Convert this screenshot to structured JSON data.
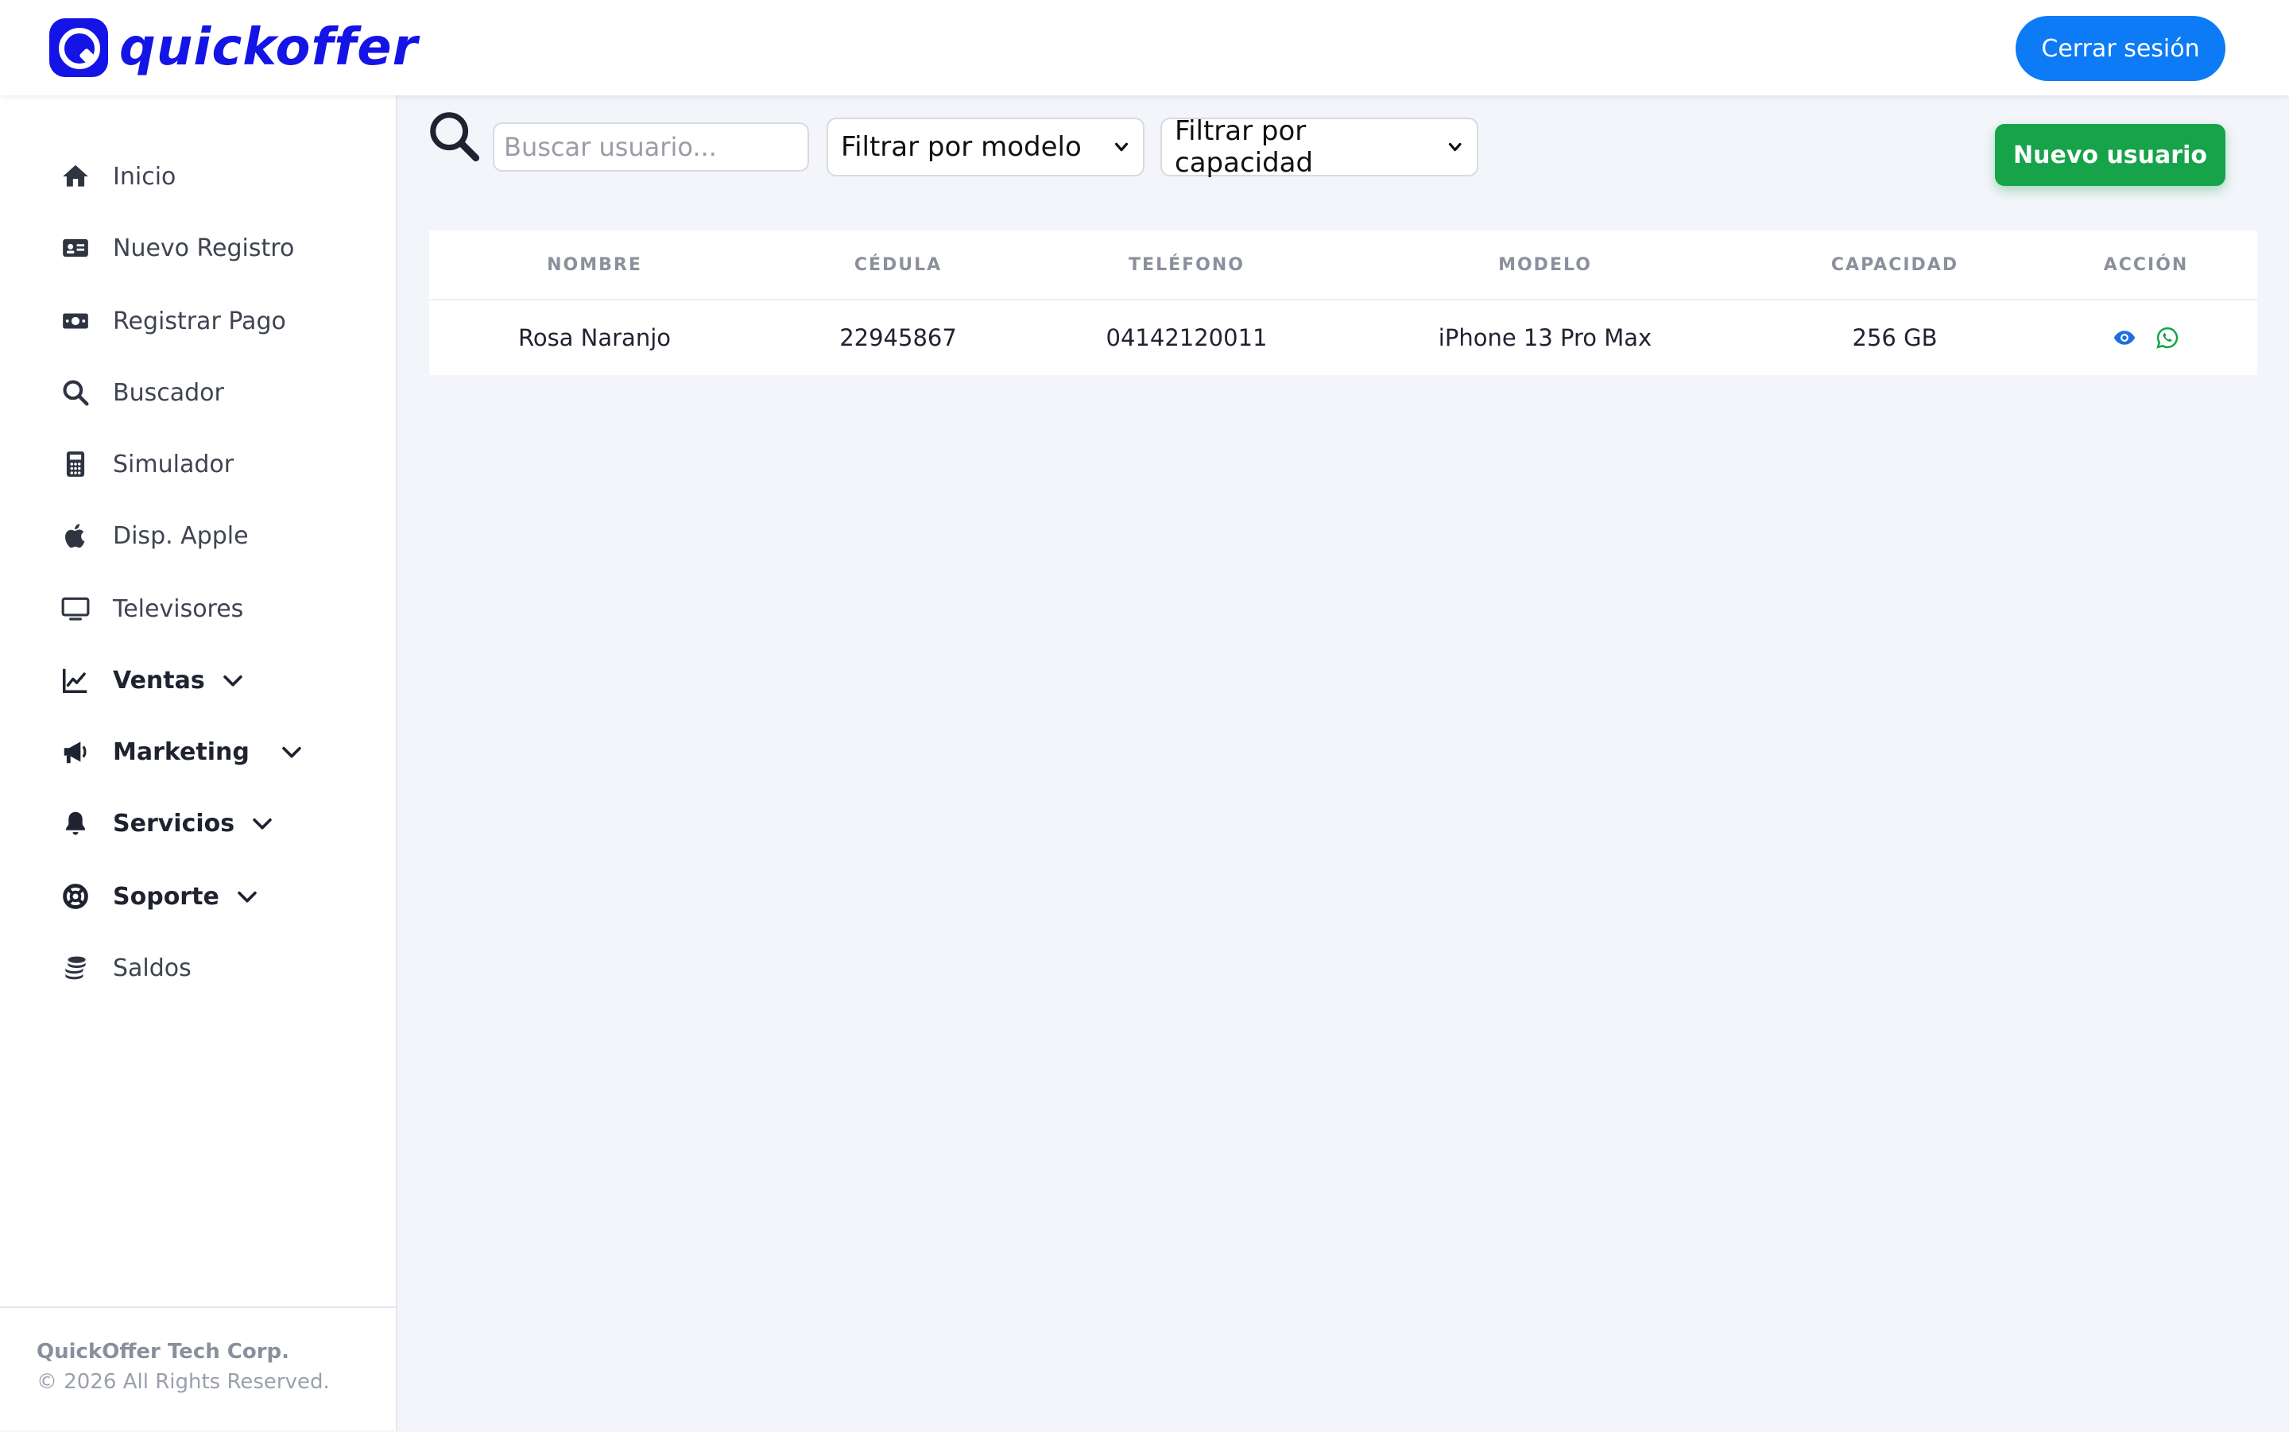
{
  "brand": {
    "name": "quickoffer",
    "primary_color": "#1414e6"
  },
  "header": {
    "logout_label": "Cerrar sesión",
    "logout_color": "#0d7bf6"
  },
  "sidebar": {
    "items": [
      {
        "label": "Inicio",
        "icon": "home-icon"
      },
      {
        "label": "Nuevo Registro",
        "icon": "id-card-icon"
      },
      {
        "label": "Registrar Pago",
        "icon": "money-icon"
      },
      {
        "label": "Buscador",
        "icon": "search-icon"
      },
      {
        "label": "Simulador",
        "icon": "calculator-icon"
      },
      {
        "label": "Disp. Apple",
        "icon": "apple-icon"
      },
      {
        "label": "Televisores",
        "icon": "tv-icon"
      },
      {
        "label": "Ventas",
        "icon": "chart-line-icon",
        "expandable": true
      },
      {
        "label": "Marketing",
        "icon": "megaphone-icon",
        "expandable": true
      },
      {
        "label": "Servicios",
        "icon": "bell-icon",
        "expandable": true
      },
      {
        "label": "Soporte",
        "icon": "lifebuoy-icon",
        "expandable": true
      },
      {
        "label": "Saldos",
        "icon": "coins-icon"
      }
    ],
    "footer": {
      "company": "QuickOffer Tech Corp.",
      "rights": "© 2026 All Rights Reserved."
    }
  },
  "toolbar": {
    "search_placeholder": "Buscar usuario...",
    "filter_model": "Filtrar por modelo",
    "filter_capacity": "Filtrar por capacidad",
    "new_user_label": "Nuevo usuario",
    "new_user_color": "#16a34a"
  },
  "table": {
    "columns": [
      "NOMBRE",
      "CÉDULA",
      "TELÉFONO",
      "MODELO",
      "CAPACIDAD",
      "ACCIÓN"
    ],
    "rows": [
      {
        "nombre": "Rosa Naranjo",
        "cedula": "22945867",
        "telefono": "04142120011",
        "modelo": "iPhone 13 Pro Max",
        "capacidad": "256 GB",
        "actions": [
          "eye-icon",
          "whatsapp-icon"
        ]
      }
    ]
  }
}
